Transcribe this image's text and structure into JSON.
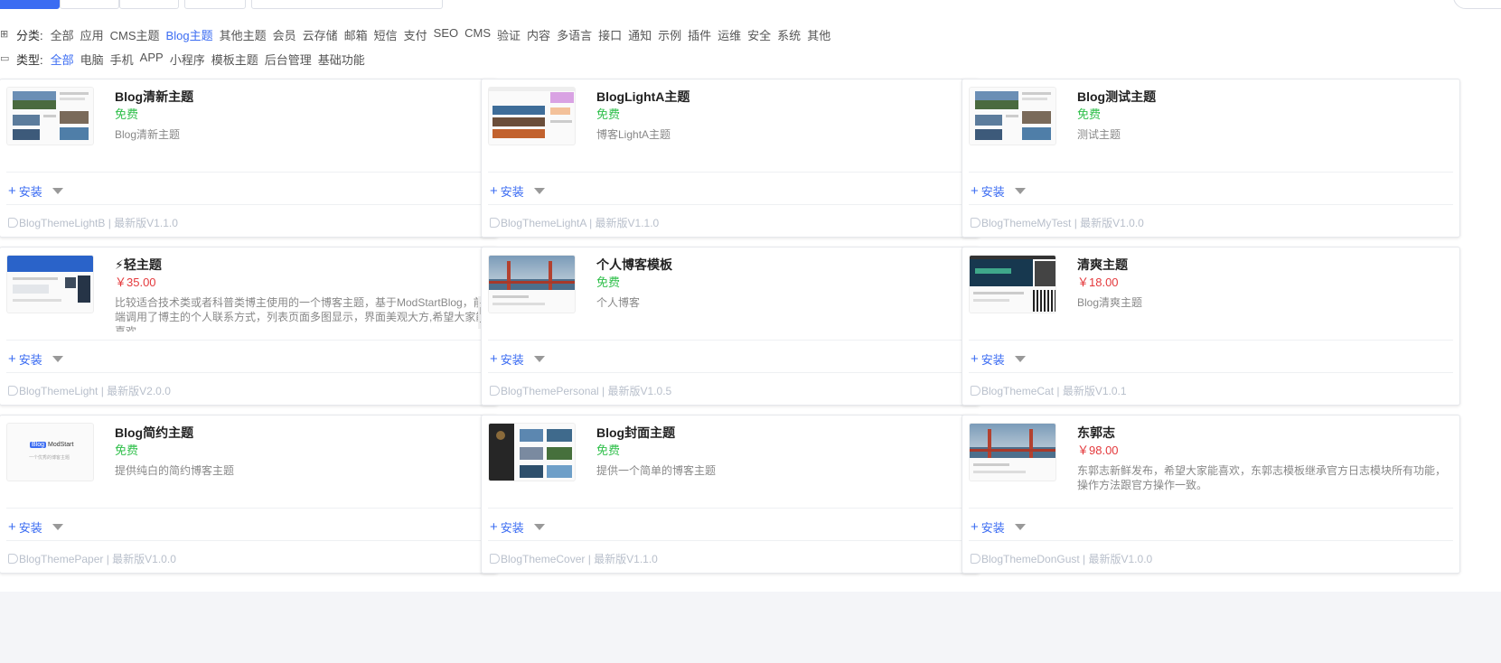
{
  "filters": {
    "category_label": "分类:",
    "categories": [
      {
        "label": "全部",
        "active": false
      },
      {
        "label": "应用",
        "active": false
      },
      {
        "label": "CMS主题",
        "active": false
      },
      {
        "label": "Blog主题",
        "active": true
      },
      {
        "label": "其他主题",
        "active": false
      },
      {
        "label": "会员",
        "active": false
      },
      {
        "label": "云存储",
        "active": false
      },
      {
        "label": "邮箱",
        "active": false
      },
      {
        "label": "短信",
        "active": false
      },
      {
        "label": "支付",
        "active": false
      },
      {
        "label": "SEO",
        "active": false
      },
      {
        "label": "CMS",
        "active": false
      },
      {
        "label": "验证",
        "active": false
      },
      {
        "label": "内容",
        "active": false
      },
      {
        "label": "多语言",
        "active": false
      },
      {
        "label": "接口",
        "active": false
      },
      {
        "label": "通知",
        "active": false
      },
      {
        "label": "示例",
        "active": false
      },
      {
        "label": "插件",
        "active": false
      },
      {
        "label": "运维",
        "active": false
      },
      {
        "label": "安全",
        "active": false
      },
      {
        "label": "系统",
        "active": false
      },
      {
        "label": "其他",
        "active": false
      }
    ],
    "type_label": "类型:",
    "types": [
      {
        "label": "全部",
        "active": true
      },
      {
        "label": "电脑",
        "active": false
      },
      {
        "label": "手机",
        "active": false
      },
      {
        "label": "APP",
        "active": false
      },
      {
        "label": "小程序",
        "active": false
      },
      {
        "label": "模板主题",
        "active": false
      },
      {
        "label": "后台管理",
        "active": false
      },
      {
        "label": "基础功能",
        "active": false
      }
    ]
  },
  "install_label": "安装",
  "cards": [
    {
      "title": "Blog清新主题",
      "price": "免费",
      "free": true,
      "desc": "Blog清新主题",
      "footer": "BlogThemeLightB | 最新版V1.1.0",
      "thumb": "photos"
    },
    {
      "title": "BlogLightA主题",
      "price": "免费",
      "free": true,
      "desc": "博客LightA主题",
      "footer": "BlogThemeLightA | 最新版V1.1.0",
      "thumb": "pink"
    },
    {
      "title": "Blog测试主题",
      "price": "免费",
      "free": true,
      "desc": "测试主题",
      "footer": "BlogThemeMyTest | 最新版V1.0.0",
      "thumb": "photos"
    },
    {
      "title": "⚡轻主题",
      "price": "￥35.00",
      "free": false,
      "desc": "比较适合技术类或者科普类博主使用的一个博客主题，基于ModStartBlog，前端调用了博主的个人联系方式，列表页面多图显示，界面美观大方,希望大家能喜欢",
      "footer": "BlogThemeLight | 最新版V2.0.0",
      "thumb": "blue",
      "scroll": true
    },
    {
      "title": "个人博客模板",
      "price": "免费",
      "free": true,
      "desc": "个人博客",
      "footer": "BlogThemePersonal | 最新版V1.0.5",
      "thumb": "bridge"
    },
    {
      "title": "清爽主题",
      "price": "￥18.00",
      "free": false,
      "desc": "Blog清爽主题",
      "footer": "BlogThemeCat | 最新版V1.0.1",
      "thumb": "dark"
    },
    {
      "title": "Blog简约主题",
      "price": "免费",
      "free": true,
      "desc": "提供纯白的简约博客主题",
      "footer": "BlogThemePaper | 最新版V1.0.0",
      "thumb": "logo",
      "logo_text": "Blog",
      "logo_sub": "ModStart",
      "logo_tagline": "一个优秀的博客主题"
    },
    {
      "title": "Blog封面主题",
      "price": "免费",
      "free": true,
      "desc": "提供一个简单的博客主题",
      "footer": "BlogThemeCover | 最新版V1.1.0",
      "thumb": "darkcol"
    },
    {
      "title": "东郭志",
      "price": "￥98.00",
      "free": false,
      "desc": "东郭志新鲜发布，希望大家能喜欢，东郭志模板继承官方日志模块所有功能，操作方法跟官方操作一致。",
      "footer": "BlogThemeDonGust | 最新版V1.0.0",
      "thumb": "bridge"
    }
  ],
  "colors": {
    "accent": "#3b6cf2",
    "free": "#2fbf4a",
    "paid": "#e4393c"
  }
}
